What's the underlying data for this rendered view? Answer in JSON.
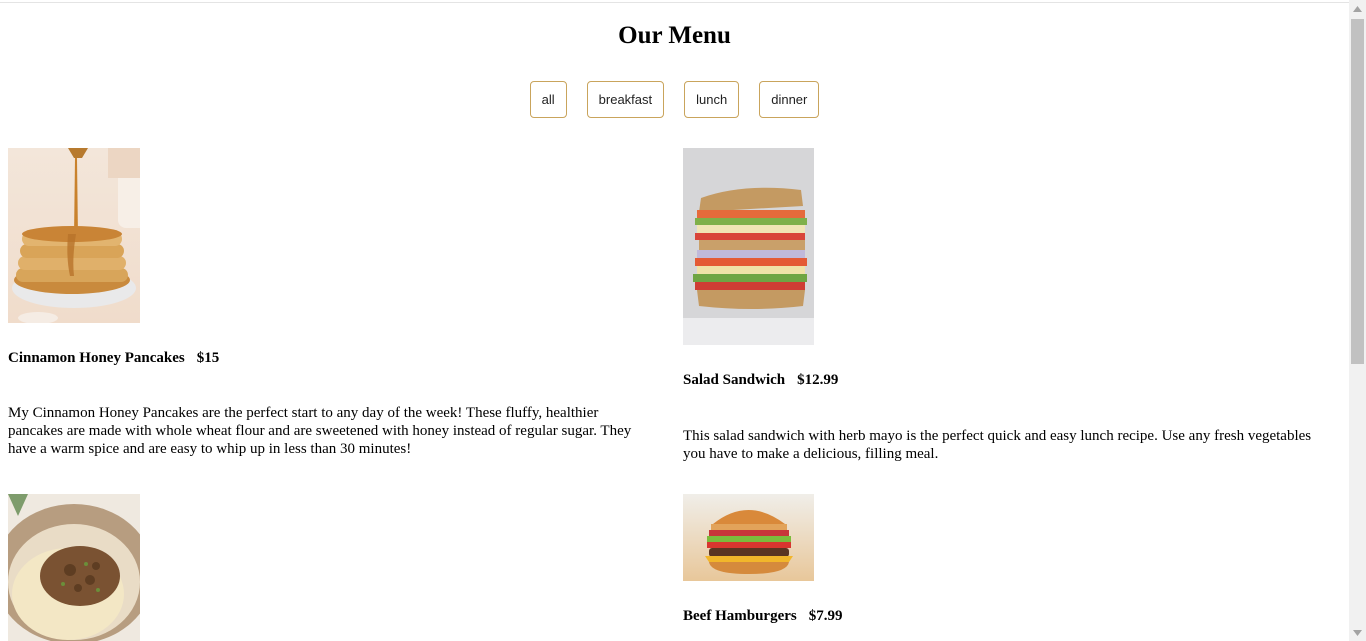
{
  "menu": {
    "title": "Our Menu",
    "filters": [
      "all",
      "breakfast",
      "lunch",
      "dinner"
    ],
    "items": [
      {
        "name": "Cinnamon Honey Pancakes",
        "price": "$15",
        "description": "My Cinnamon Honey Pancakes are the perfect start to any day of the week! These fluffy, healthier pancakes are made with whole wheat flour and are sweetened with honey instead of regular sugar. They have a warm spice and are easy to whip up in less than 30 minutes!"
      },
      {
        "name": "Salad Sandwich",
        "price": "$12.99",
        "description": "This salad sandwich with herb mayo is the perfect quick and easy lunch recipe. Use any fresh vegetables you have to make a delicious, filling meal."
      },
      {
        "name": "",
        "price": "",
        "description": ""
      },
      {
        "name": "Beef Hamburgers",
        "price": "$7.99",
        "description": ""
      }
    ]
  },
  "icons": {
    "scroll_up": "chevron-up-icon",
    "scroll_down": "chevron-down-icon"
  },
  "colors": {
    "filter_border": "#c9a45c",
    "scroll_track": "#f1f1f1",
    "scroll_thumb": "#c1c1c1"
  }
}
